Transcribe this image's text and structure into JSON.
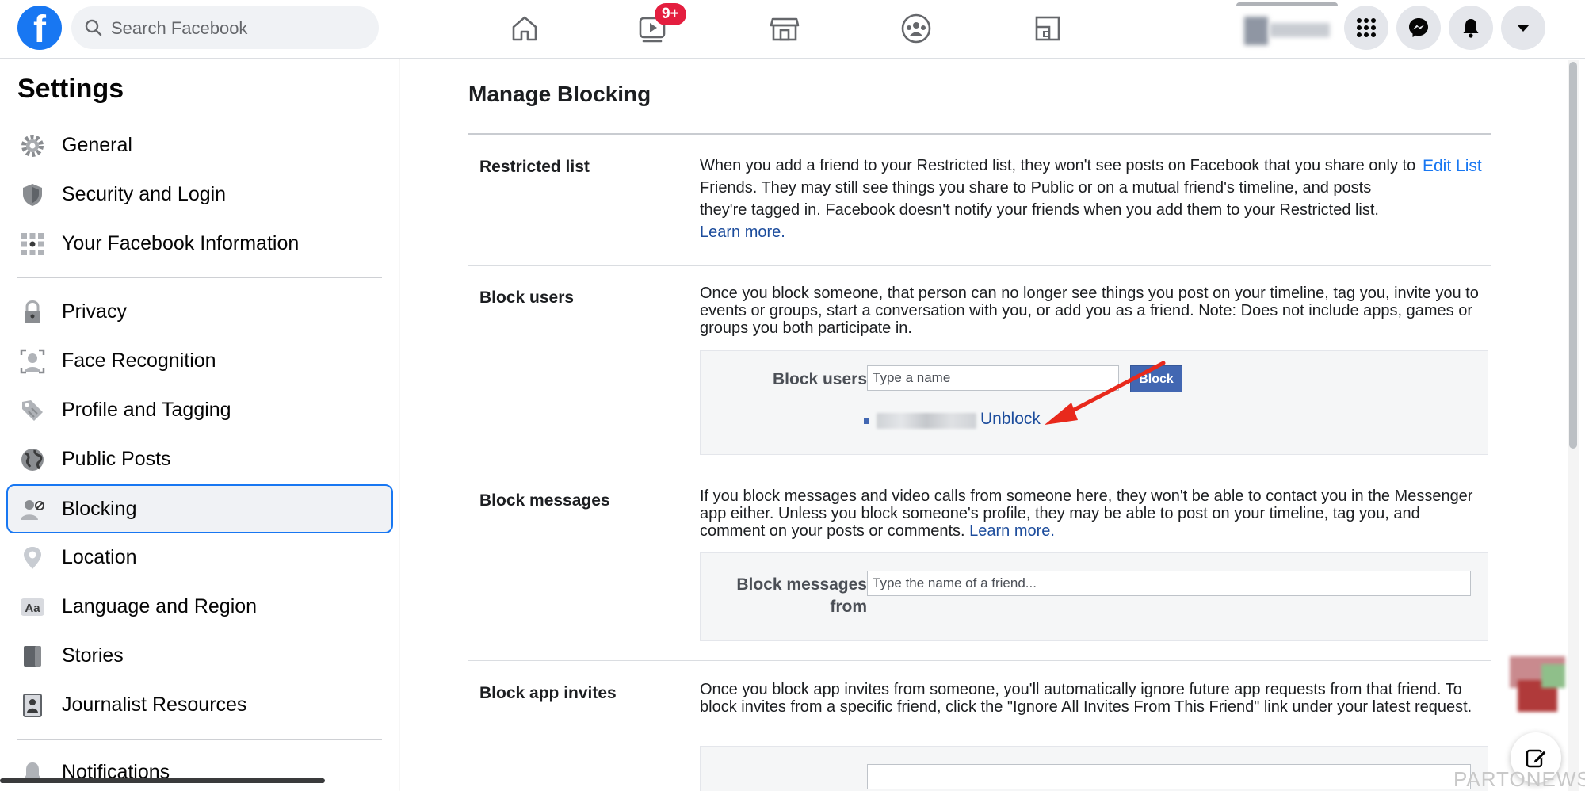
{
  "topbar": {
    "logo_letter": "f",
    "search_placeholder": "Search Facebook",
    "watch_badge": "9+",
    "nav_icons": [
      "home-icon",
      "watch-icon",
      "marketplace-icon",
      "groups-icon",
      "gaming-icon"
    ],
    "right_icons": [
      "menu-grid-icon",
      "messenger-icon",
      "notifications-bell-icon",
      "account-caret-icon"
    ]
  },
  "sidebar": {
    "title": "Settings",
    "items": [
      {
        "label": "General",
        "icon": "gear-icon"
      },
      {
        "label": "Security and Login",
        "icon": "shield-icon"
      },
      {
        "label": "Your Facebook Information",
        "icon": "grid-dots-icon"
      },
      {
        "label": "Privacy",
        "icon": "lock-icon"
      },
      {
        "label": "Face Recognition",
        "icon": "face-icon"
      },
      {
        "label": "Profile and Tagging",
        "icon": "tag-icon"
      },
      {
        "label": "Public Posts",
        "icon": "globe-icon"
      },
      {
        "label": "Blocking",
        "icon": "block-person-icon",
        "active": true
      },
      {
        "label": "Location",
        "icon": "location-pin-icon"
      },
      {
        "label": "Language and Region",
        "icon": "language-aa-icon"
      },
      {
        "label": "Stories",
        "icon": "book-icon"
      },
      {
        "label": "Journalist Resources",
        "icon": "id-card-icon"
      },
      {
        "label": "Notifications",
        "icon": "bell-icon"
      }
    ]
  },
  "main": {
    "title": "Manage Blocking",
    "restricted": {
      "label": "Restricted list",
      "desc": "When you add a friend to your Restricted list, they won't see posts on Facebook that you share only to Friends. They may still see things you share to Public or on a mutual friend's timeline, and posts they're tagged in. Facebook doesn't notify your friends when you add them to your Restricted list.",
      "learn_more": "Learn more.",
      "edit_list": "Edit List"
    },
    "block_users": {
      "label": "Block users",
      "desc": "Once you block someone, that person can no longer see things you post on your timeline, tag you, invite you to events or groups, start a conversation with you, or add you as a friend. Note: Does not include apps, games or groups you both participate in.",
      "field_label": "Block users",
      "input_placeholder": "Type a name",
      "button": "Block",
      "unblock": "Unblock"
    },
    "block_messages": {
      "label": "Block messages",
      "desc": "If you block messages and video calls from someone here, they won't be able to contact you in the Messenger app either. Unless you block someone's profile, they may be able to post on your timeline, tag you, and comment on your posts or comments.",
      "learn_more": "Learn more.",
      "field_label_line1": "Block messages",
      "field_label_line2": "from",
      "input_placeholder": "Type the name of a friend..."
    },
    "block_app_invites": {
      "label": "Block app invites",
      "desc": "Once you block app invites from someone, you'll automatically ignore future app requests from that friend. To block invites from a specific friend, click the \"Ignore All Invites From This Friend\" link under your latest request."
    }
  },
  "watermark": "PARTONEWS.IR",
  "colors": {
    "brand": "#1877f2",
    "badge": "#e41e3f",
    "block_button": "#4267b2",
    "annotation_arrow": "#e8291c"
  }
}
